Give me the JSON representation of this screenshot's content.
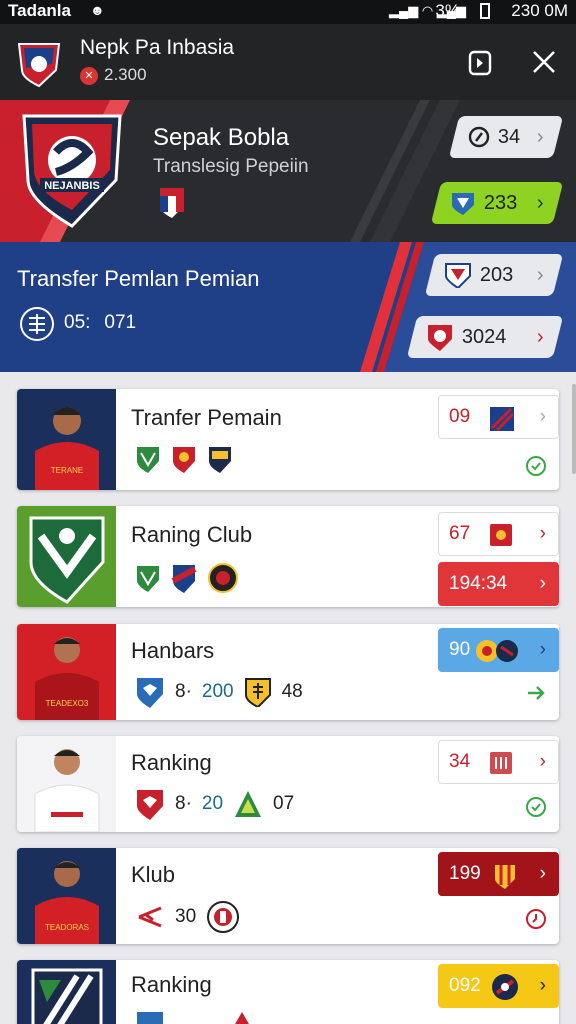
{
  "status_bar": {
    "carrier": "Tadanla",
    "battery": "3%",
    "time": "230 0M"
  },
  "app_bar": {
    "title": "Nepk Pa Inbasia",
    "subtitle": "2.300"
  },
  "hero": {
    "title": "Sepak Bobla",
    "subtitle": "Translesig Pepeiin",
    "crest_text": "NEJANBIS",
    "stat_top": "34",
    "stat_bottom": "233"
  },
  "transfer_band": {
    "title": "Transfer Pemlan Pemian",
    "time_label": "05:",
    "time_value": "071",
    "stat_top": "203",
    "stat_bottom": "3024"
  },
  "cards": [
    {
      "name": "Tranfer Pemain",
      "chip_value": "09",
      "chip_style": "light",
      "status": "check"
    },
    {
      "name": "Raning Club",
      "chip_value": "67",
      "chip_style": "light",
      "chip2_value": "194:34",
      "status": "none"
    },
    {
      "name": "Hanbars",
      "chip_value": "90",
      "chip_style": "blue",
      "stat_a": "8·",
      "stat_b": "200",
      "stat_c": "48",
      "status": "arrow"
    },
    {
      "name": "Ranking",
      "chip_value": "34",
      "chip_style": "light",
      "stat_a": "8·",
      "stat_b": "20",
      "stat_c": "07",
      "status": "check"
    },
    {
      "name": "Klub",
      "chip_value": "199",
      "chip_style": "darkred",
      "stat_b": "30",
      "status": "clock"
    },
    {
      "name": "Ranking",
      "chip_value": "092",
      "chip_style": "yellow",
      "status": "none"
    }
  ]
}
